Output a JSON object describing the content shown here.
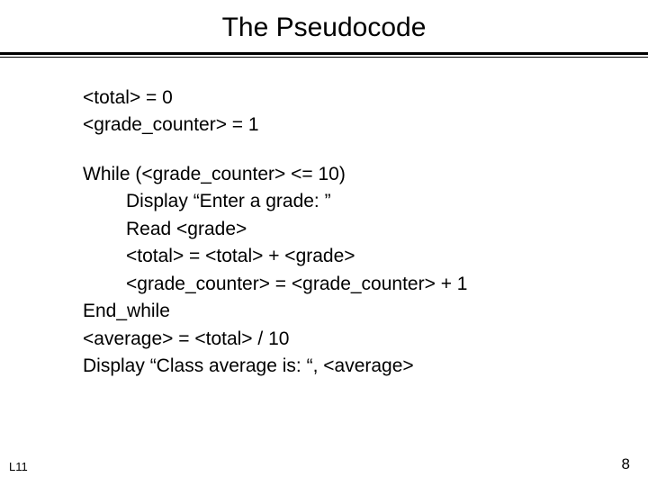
{
  "title": "The Pseudocode",
  "init": {
    "line1": "<total> = 0",
    "line2": "<grade_counter> = 1"
  },
  "loop": {
    "while_line": "While  (<grade_counter> <= 10)",
    "body1": "Display “Enter a grade: ”",
    "body2": "Read <grade>",
    "body3": "<total> = <total> + <grade>",
    "body4": "<grade_counter> = <grade_counter> + 1",
    "end_while": "End_while",
    "avg_line": "<average> = <total> / 10",
    "display_line": "Display “Class average is: “, <average>"
  },
  "footer": {
    "left": "L11",
    "right": "8"
  }
}
